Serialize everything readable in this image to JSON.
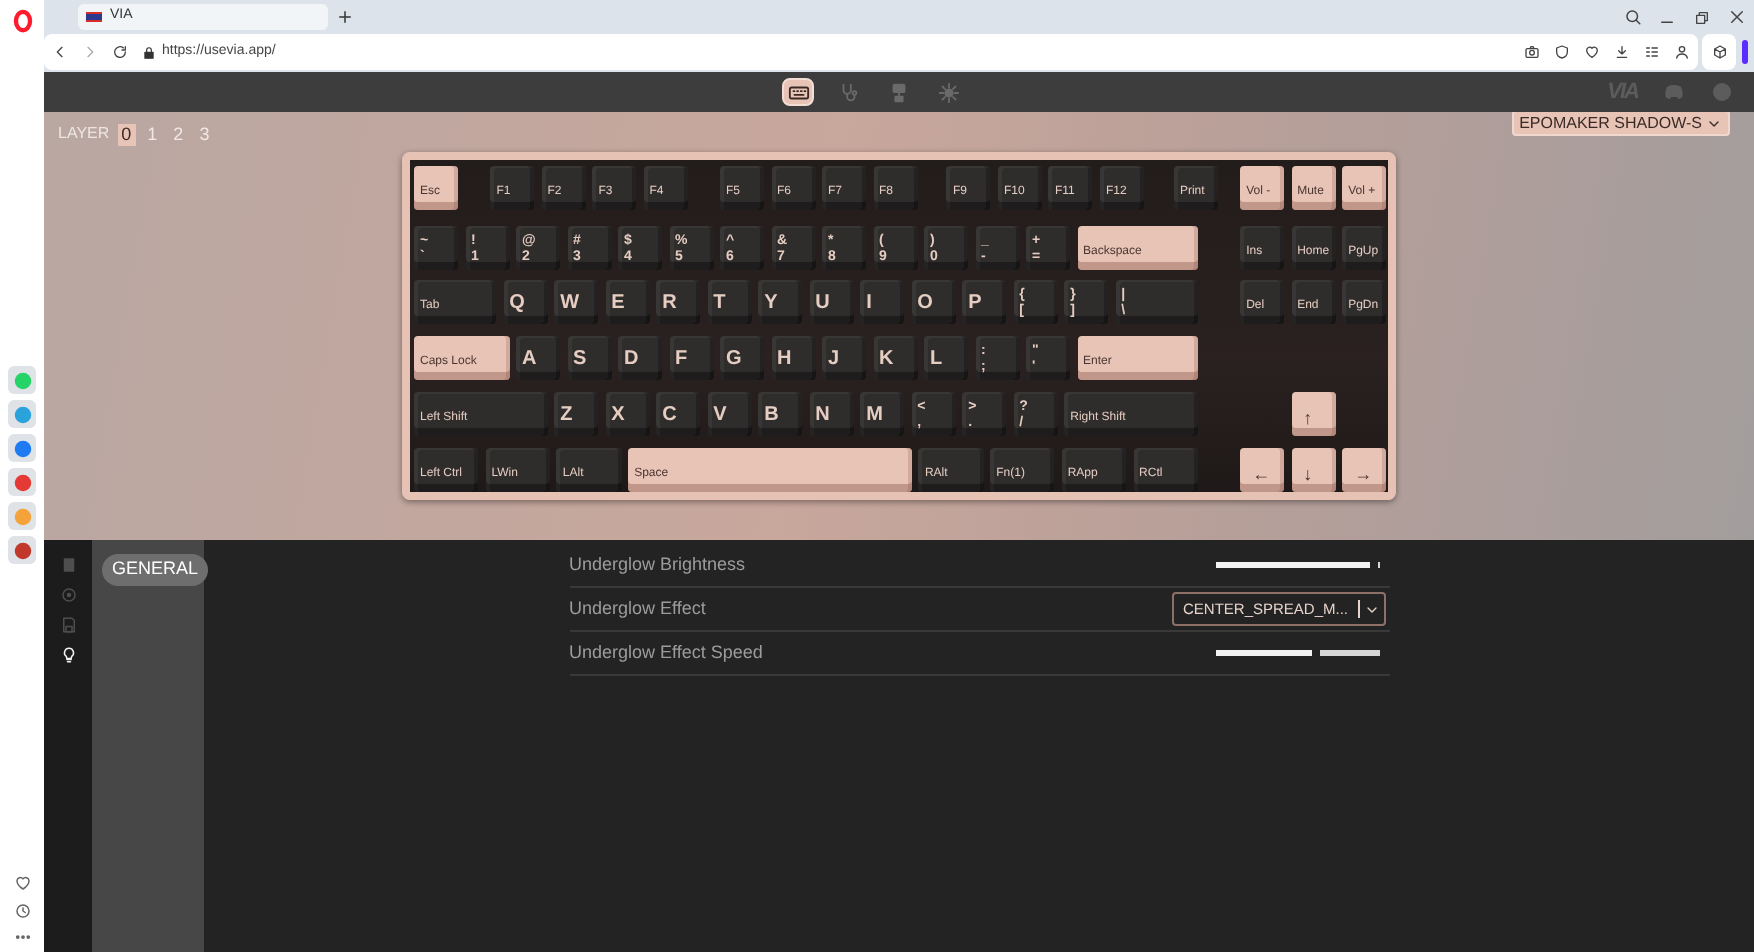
{
  "browser": {
    "tabs": [
      {
        "title": "VIA",
        "selected": true
      }
    ],
    "address": "https://usevia.app/"
  },
  "opera_sidebar": {
    "apps": [
      {
        "color": "#25d366"
      },
      {
        "color": "#2aa3dc"
      },
      {
        "color": "#1e7bf2"
      },
      {
        "color": "#e53935"
      },
      {
        "color": "#f4a23a"
      },
      {
        "color": "#c0392b"
      }
    ]
  },
  "via": {
    "nav_tabs": [
      {
        "kind": "keyboard",
        "selected": true
      },
      {
        "kind": "stethoscope",
        "selected": false
      },
      {
        "kind": "stamp",
        "selected": false
      },
      {
        "kind": "gear",
        "selected": false
      }
    ],
    "logo": "VIA",
    "layer": {
      "label": "LAYER",
      "layers": [
        {
          "label": "0",
          "selected": true
        },
        {
          "label": "1",
          "selected": false
        },
        {
          "label": "2",
          "selected": false
        },
        {
          "label": "3",
          "selected": false
        }
      ]
    },
    "device_select": "EPOMAKER SHADOW-S",
    "keyboard": {
      "keys": [
        {
          "kind": "mod",
          "legends": [
            "Esc"
          ],
          "color": "#e8c4b7"
        },
        {
          "kind": "mod",
          "legends": [
            "F1"
          ],
          "color": "#2f2c2c"
        },
        {
          "kind": "mod",
          "legends": [
            "F2"
          ],
          "color": "#2f2c2c"
        },
        {
          "kind": "mod",
          "legends": [
            "F3"
          ],
          "color": "#2f2c2c"
        },
        {
          "kind": "mod",
          "legends": [
            "F4"
          ],
          "color": "#2f2c2c"
        },
        {
          "kind": "mod",
          "legends": [
            "F5"
          ],
          "color": "#2f2c2c"
        },
        {
          "kind": "mod",
          "legends": [
            "F6"
          ],
          "color": "#2f2c2c"
        },
        {
          "kind": "mod",
          "legends": [
            "F7"
          ],
          "color": "#2f2c2c"
        },
        {
          "kind": "mod",
          "legends": [
            "F8"
          ],
          "color": "#2f2c2c"
        },
        {
          "kind": "mod",
          "legends": [
            "F9"
          ],
          "color": "#2f2c2c"
        },
        {
          "kind": "mod",
          "legends": [
            "F10"
          ],
          "color": "#2f2c2c"
        },
        {
          "kind": "mod",
          "legends": [
            "F11"
          ],
          "color": "#2f2c2c"
        },
        {
          "kind": "mod",
          "legends": [
            "F12"
          ],
          "color": "#2f2c2c"
        },
        {
          "kind": "mod",
          "legends": [
            "Print"
          ],
          "color": "#2f2c2c"
        },
        {
          "kind": "mod",
          "legends": [
            "Vol -"
          ],
          "color": "#e8c4b7"
        },
        {
          "kind": "mod",
          "legends": [
            "Mute"
          ],
          "color": "#e8c4b7"
        },
        {
          "kind": "mod",
          "legends": [
            "Vol +"
          ],
          "color": "#e8c4b7"
        },
        {
          "kind": "dual",
          "legends": [
            "~",
            "`"
          ],
          "color": "#2f2c2c"
        },
        {
          "kind": "dual",
          "legends": [
            "!",
            "1"
          ],
          "color": "#2f2c2c"
        },
        {
          "kind": "dual",
          "legends": [
            "@",
            "2"
          ],
          "color": "#2f2c2c"
        },
        {
          "kind": "dual",
          "legends": [
            "#",
            "3"
          ],
          "color": "#2f2c2c"
        },
        {
          "kind": "dual",
          "legends": [
            "$",
            "4"
          ],
          "color": "#2f2c2c"
        },
        {
          "kind": "dual",
          "legends": [
            "%",
            "5"
          ],
          "color": "#2f2c2c"
        },
        {
          "kind": "dual",
          "legends": [
            "^",
            "6"
          ],
          "color": "#2f2c2c"
        },
        {
          "kind": "dual",
          "legends": [
            "&",
            "7"
          ],
          "color": "#2f2c2c"
        },
        {
          "kind": "dual",
          "legends": [
            "*",
            "8"
          ],
          "color": "#2f2c2c"
        },
        {
          "kind": "dual",
          "legends": [
            "(",
            "9"
          ],
          "color": "#2f2c2c"
        },
        {
          "kind": "dual",
          "legends": [
            ")",
            "0"
          ],
          "color": "#2f2c2c"
        },
        {
          "kind": "dual",
          "legends": [
            "_",
            "-"
          ],
          "color": "#2f2c2c"
        },
        {
          "kind": "dual",
          "legends": [
            "+",
            "="
          ],
          "color": "#2f2c2c"
        },
        {
          "kind": "mod",
          "legends": [
            "Backspace"
          ],
          "color": "#e8c4b7"
        },
        {
          "kind": "mod",
          "legends": [
            "Ins"
          ],
          "color": "#2f2c2c"
        },
        {
          "kind": "mod",
          "legends": [
            "Home"
          ],
          "color": "#2f2c2c"
        },
        {
          "kind": "mod",
          "legends": [
            "PgUp"
          ],
          "color": "#2f2c2c"
        },
        {
          "kind": "mod",
          "legends": [
            "Tab"
          ],
          "color": "#2f2c2c"
        },
        {
          "kind": "alpha",
          "legends": [
            "Q"
          ],
          "color": "#2f2c2c"
        },
        {
          "kind": "alpha",
          "legends": [
            "W"
          ],
          "color": "#2f2c2c"
        },
        {
          "kind": "alpha",
          "legends": [
            "E"
          ],
          "color": "#2f2c2c"
        },
        {
          "kind": "alpha",
          "legends": [
            "R"
          ],
          "color": "#2f2c2c"
        },
        {
          "kind": "alpha",
          "legends": [
            "T"
          ],
          "color": "#2f2c2c"
        },
        {
          "kind": "alpha",
          "legends": [
            "Y"
          ],
          "color": "#2f2c2c"
        },
        {
          "kind": "alpha",
          "legends": [
            "U"
          ],
          "color": "#2f2c2c"
        },
        {
          "kind": "alpha",
          "legends": [
            "I"
          ],
          "color": "#2f2c2c"
        },
        {
          "kind": "alpha",
          "legends": [
            "O"
          ],
          "color": "#2f2c2c"
        },
        {
          "kind": "alpha",
          "legends": [
            "P"
          ],
          "color": "#2f2c2c"
        },
        {
          "kind": "dual",
          "legends": [
            "{",
            "["
          ],
          "color": "#2f2c2c"
        },
        {
          "kind": "dual",
          "legends": [
            "}",
            "]"
          ],
          "color": "#2f2c2c"
        },
        {
          "kind": "dual",
          "legends": [
            "|",
            "\\"
          ],
          "color": "#2f2c2c"
        },
        {
          "kind": "mod",
          "legends": [
            "Del"
          ],
          "color": "#2f2c2c"
        },
        {
          "kind": "mod",
          "legends": [
            "End"
          ],
          "color": "#2f2c2c"
        },
        {
          "kind": "mod",
          "legends": [
            "PgDn"
          ],
          "color": "#2f2c2c"
        },
        {
          "kind": "mod",
          "legends": [
            "Caps Lock"
          ],
          "color": "#e8c4b7"
        },
        {
          "kind": "alpha",
          "legends": [
            "A"
          ],
          "color": "#2f2c2c"
        },
        {
          "kind": "alpha",
          "legends": [
            "S"
          ],
          "color": "#2f2c2c"
        },
        {
          "kind": "alpha",
          "legends": [
            "D"
          ],
          "color": "#2f2c2c"
        },
        {
          "kind": "alpha",
          "legends": [
            "F"
          ],
          "color": "#2f2c2c"
        },
        {
          "kind": "alpha",
          "legends": [
            "G"
          ],
          "color": "#2f2c2c"
        },
        {
          "kind": "alpha",
          "legends": [
            "H"
          ],
          "color": "#2f2c2c"
        },
        {
          "kind": "alpha",
          "legends": [
            "J"
          ],
          "color": "#2f2c2c"
        },
        {
          "kind": "alpha",
          "legends": [
            "K"
          ],
          "color": "#2f2c2c"
        },
        {
          "kind": "alpha",
          "legends": [
            "L"
          ],
          "color": "#2f2c2c"
        },
        {
          "kind": "dual",
          "legends": [
            ":",
            ";"
          ],
          "color": "#2f2c2c"
        },
        {
          "kind": "dual",
          "legends": [
            "\"",
            "'"
          ],
          "color": "#2f2c2c"
        },
        {
          "kind": "mod",
          "legends": [
            "Enter"
          ],
          "color": "#e8c4b7"
        },
        {
          "kind": "mod",
          "legends": [
            "Left Shift"
          ],
          "color": "#2f2c2c"
        },
        {
          "kind": "alpha",
          "legends": [
            "Z"
          ],
          "color": "#2f2c2c"
        },
        {
          "kind": "alpha",
          "legends": [
            "X"
          ],
          "color": "#2f2c2c"
        },
        {
          "kind": "alpha",
          "legends": [
            "C"
          ],
          "color": "#2f2c2c"
        },
        {
          "kind": "alpha",
          "legends": [
            "V"
          ],
          "color": "#2f2c2c"
        },
        {
          "kind": "alpha",
          "legends": [
            "B"
          ],
          "color": "#2f2c2c"
        },
        {
          "kind": "alpha",
          "legends": [
            "N"
          ],
          "color": "#2f2c2c"
        },
        {
          "kind": "alpha",
          "legends": [
            "M"
          ],
          "color": "#2f2c2c"
        },
        {
          "kind": "dual",
          "legends": [
            "<",
            ","
          ],
          "color": "#2f2c2c"
        },
        {
          "kind": "dual",
          "legends": [
            ">",
            "."
          ],
          "color": "#2f2c2c"
        },
        {
          "kind": "dual",
          "legends": [
            "?",
            "/"
          ],
          "color": "#2f2c2c"
        },
        {
          "kind": "mod",
          "legends": [
            "Right Shift"
          ],
          "color": "#2f2c2c"
        },
        {
          "kind": "arrow",
          "legends": [
            "↑"
          ],
          "color": "#e8c4b7"
        },
        {
          "kind": "mod",
          "legends": [
            "Left Ctrl"
          ],
          "color": "#2f2c2c"
        },
        {
          "kind": "mod",
          "legends": [
            "LWin"
          ],
          "color": "#2f2c2c"
        },
        {
          "kind": "mod",
          "legends": [
            "LAlt"
          ],
          "color": "#2f2c2c"
        },
        {
          "kind": "mod",
          "legends": [
            "Space"
          ],
          "color": "#e8c4b7"
        },
        {
          "kind": "mod",
          "legends": [
            "RAlt"
          ],
          "color": "#2f2c2c"
        },
        {
          "kind": "mod",
          "legends": [
            "Fn(1)"
          ],
          "color": "#2f2c2c"
        },
        {
          "kind": "mod",
          "legends": [
            "RApp"
          ],
          "color": "#2f2c2c"
        },
        {
          "kind": "mod",
          "legends": [
            "RCtl"
          ],
          "color": "#2f2c2c"
        },
        {
          "kind": "arrow",
          "legends": [
            "←"
          ],
          "color": "#e8c4b7"
        },
        {
          "kind": "arrow",
          "legends": [
            "↓"
          ],
          "color": "#e8c4b7"
        },
        {
          "kind": "arrow",
          "legends": [
            "→"
          ],
          "color": "#e8c4b7"
        }
      ]
    },
    "config": {
      "menu_icons": [
        {
          "kind": "document",
          "selected": false
        },
        {
          "kind": "circle",
          "selected": false
        },
        {
          "kind": "floppy",
          "selected": false
        },
        {
          "kind": "lightbulb",
          "selected": true
        }
      ],
      "categories": [
        {
          "label": "GENERAL",
          "selected": true
        }
      ],
      "settings": [
        {
          "kind": "slider",
          "label": "Underglow Brightness",
          "level": 0.96
        },
        {
          "kind": "select",
          "label": "Underglow Effect",
          "value": "CENTER_SPREAD_M..."
        },
        {
          "kind": "slider",
          "label": "Underglow Effect Speed",
          "level": 0.6
        }
      ]
    }
  }
}
